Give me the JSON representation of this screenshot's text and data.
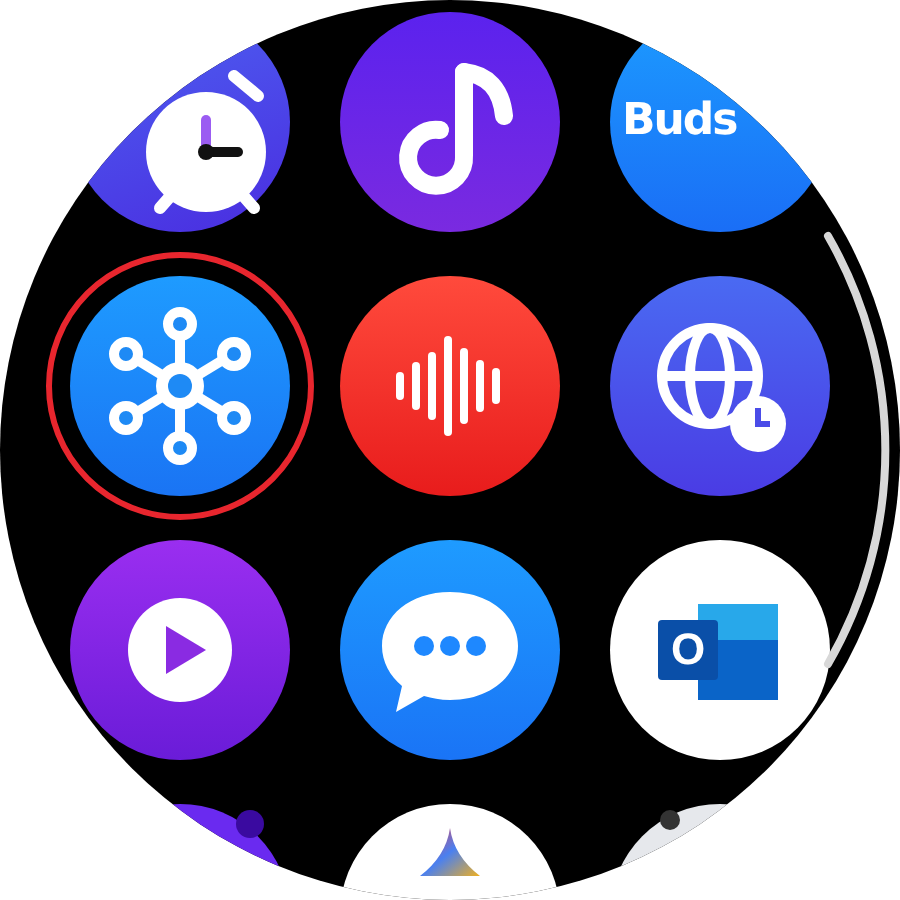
{
  "apps": [
    {
      "kind": "alarm",
      "selected": false
    },
    {
      "kind": "music",
      "selected": false
    },
    {
      "kind": "buds",
      "label": "Buds",
      "selected": false
    },
    {
      "kind": "hub",
      "selected": true
    },
    {
      "kind": "recorder",
      "selected": false
    },
    {
      "kind": "world-clock",
      "selected": false
    },
    {
      "kind": "player",
      "selected": false
    },
    {
      "kind": "messages",
      "selected": false
    },
    {
      "kind": "outlook",
      "label": "O",
      "selected": false
    },
    {
      "kind": "purple-ring",
      "selected": false
    },
    {
      "kind": "gradient",
      "selected": false
    },
    {
      "kind": "grey",
      "selected": false
    }
  ]
}
